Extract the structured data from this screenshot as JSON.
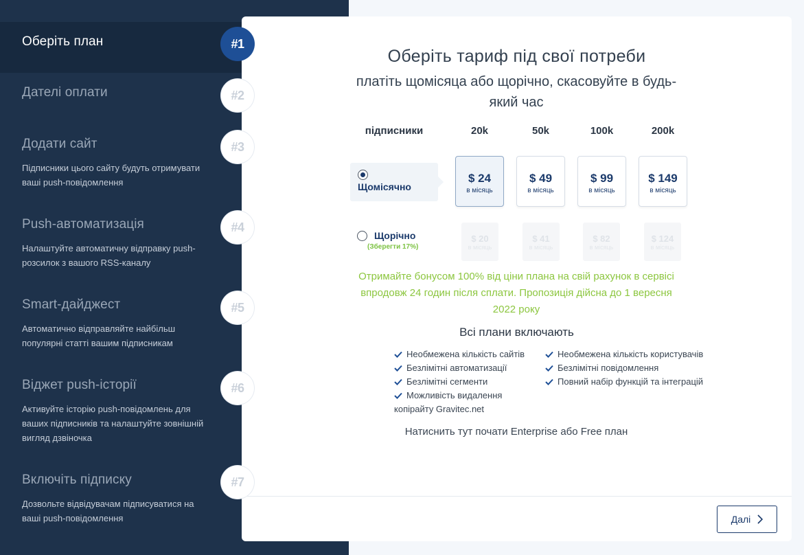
{
  "sidebar": {
    "steps": [
      {
        "num": "#1",
        "title": "Оберіть план",
        "desc": ""
      },
      {
        "num": "#2",
        "title": "Дателі оплати",
        "desc": ""
      },
      {
        "num": "#3",
        "title": "Додати сайт",
        "desc": "Підписники цього сайту будуть отримувати ваші push-повідомлення"
      },
      {
        "num": "#4",
        "title": "Push-автоматизація",
        "desc": "Налаштуйте автоматичну відправку push-розсилок з вашого RSS-каналу"
      },
      {
        "num": "#5",
        "title": "Smart-дайджест",
        "desc": "Автоматично відправляйте найбільш популярні статті вашим підписникам"
      },
      {
        "num": "#6",
        "title": "Віджет push-історії",
        "desc": "Активуйте історію push-повідомлень для ваших підписників та налаштуйте зовнішній вигляд дзвіночка"
      },
      {
        "num": "#7",
        "title": "Включіть підписку",
        "desc": "Дозвольте відвідувачам підписуватися на ваші push-повідомлення"
      }
    ]
  },
  "main": {
    "title": "Оберіть тариф під свої потреби",
    "subtitle": "платіть щомісяца або щорічно, скасовуйте в будь-який час",
    "columns": {
      "label": "підписники",
      "tiers": [
        "20k",
        "50k",
        "100k",
        "200k"
      ]
    },
    "monthly": {
      "label": "Щомісячно",
      "selected": true,
      "prices": [
        {
          "amount": "$ 24",
          "per": "в місяць"
        },
        {
          "amount": "$ 49",
          "per": "в місяць"
        },
        {
          "amount": "$ 99",
          "per": "в місяць"
        },
        {
          "amount": "$ 149",
          "per": "в місяць"
        }
      ]
    },
    "yearly": {
      "label": "Щорічно",
      "save": "(Зберегти 17%)",
      "selected": false,
      "prices": [
        {
          "amount": "$ 20",
          "per": "в місяць"
        },
        {
          "amount": "$ 41",
          "per": "в місяць"
        },
        {
          "amount": "$ 82",
          "per": "в місяць"
        },
        {
          "amount": "$ 124",
          "per": "в місяць"
        }
      ]
    },
    "bonus": "Отримайте бонусом 100% від ціни плана на свій рахунок в сервісі впродовж 24 годин після сплати. Пропозиція дійсна до 1 вересня 2022 року",
    "includes_title": "Всі плани включають",
    "features_left": [
      "Необмежена кількість сайтів",
      "Безлімітні автоматизації",
      "Безлімітні сегменти",
      "Можливість видалення копірайту Gravitec.net"
    ],
    "features_right": [
      "Необмежена кількість користувачів",
      "Безлімітні повідомлення",
      "Повний набір функцій та інтеграцій"
    ],
    "enterprise_link": "Натиснить тут почати Enterprise або Free план",
    "next_label": "Далі"
  },
  "colors": {
    "sidebar_bg": "#1e324b",
    "accent": "#1e4f96",
    "brand_text": "#1b3a6b",
    "bonus_green": "#8cc63f"
  }
}
